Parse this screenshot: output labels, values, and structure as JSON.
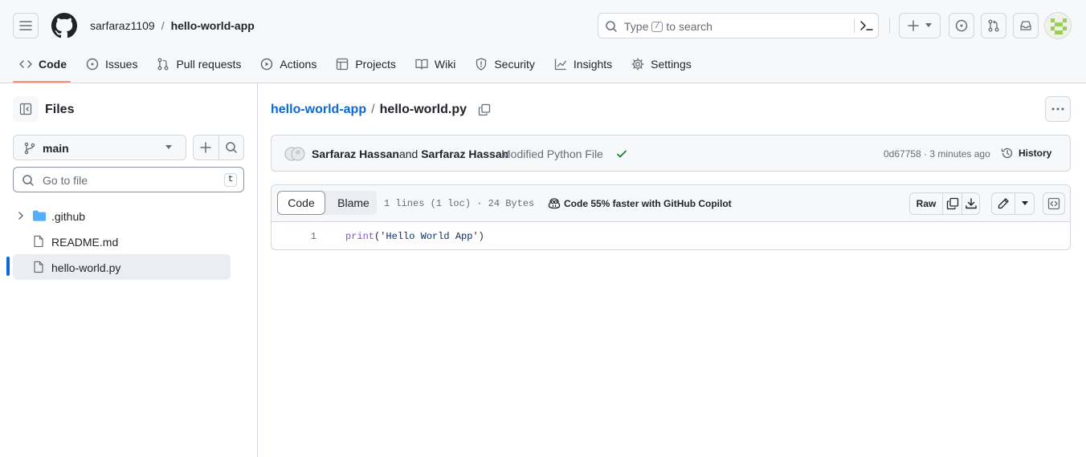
{
  "header": {
    "owner": "sarfaraz1109",
    "separator": "/",
    "repo": "hello-world-app",
    "search": {
      "prefix": "Type",
      "key": "/",
      "suffix": "to search"
    },
    "icons": [
      "hamburger-icon",
      "github-logo",
      "search-icon",
      "command-palette-icon",
      "plus-icon",
      "issue-icon",
      "pull-request-icon",
      "inbox-icon",
      "avatar"
    ]
  },
  "tabs": [
    {
      "label": "Code",
      "icon": "code-icon",
      "active": true
    },
    {
      "label": "Issues",
      "icon": "issue-icon"
    },
    {
      "label": "Pull requests",
      "icon": "pull-request-icon"
    },
    {
      "label": "Actions",
      "icon": "play-icon"
    },
    {
      "label": "Projects",
      "icon": "table-icon"
    },
    {
      "label": "Wiki",
      "icon": "book-icon"
    },
    {
      "label": "Security",
      "icon": "shield-icon"
    },
    {
      "label": "Insights",
      "icon": "graph-icon"
    },
    {
      "label": "Settings",
      "icon": "gear-icon"
    }
  ],
  "sidebar": {
    "title": "Files",
    "branch": "main",
    "go_to_file": {
      "placeholder": "Go to file",
      "shortcut": "t"
    },
    "tree": [
      {
        "name": ".github",
        "type": "folder"
      },
      {
        "name": "README.md",
        "type": "file"
      },
      {
        "name": "hello-world.py",
        "type": "file",
        "selected": true
      }
    ]
  },
  "main": {
    "path_root": "hello-world-app",
    "path_sep": "/",
    "path_file": "hello-world.py",
    "commit": {
      "author1": "Sarfaraz Hassan",
      "and": "and",
      "author2": "Sarfaraz Hassan",
      "message": "Modified Python File",
      "meta": "0d67758 · 3 minutes ago",
      "history_label": "History"
    },
    "file": {
      "code_tab": "Code",
      "blame_tab": "Blame",
      "stats": "1 lines (1 loc) · 24 Bytes",
      "copilot": "Code 55% faster with GitHub Copilot",
      "raw_label": "Raw",
      "lines": [
        {
          "number": "1",
          "fn": "print",
          "open": "(",
          "string": "'Hello World App'",
          "close": ")"
        }
      ]
    }
  },
  "colors": {
    "accent_link": "#0969da",
    "tab_underline": "#fd8c73",
    "success": "#1a7f37",
    "folder": "#54aeff"
  }
}
